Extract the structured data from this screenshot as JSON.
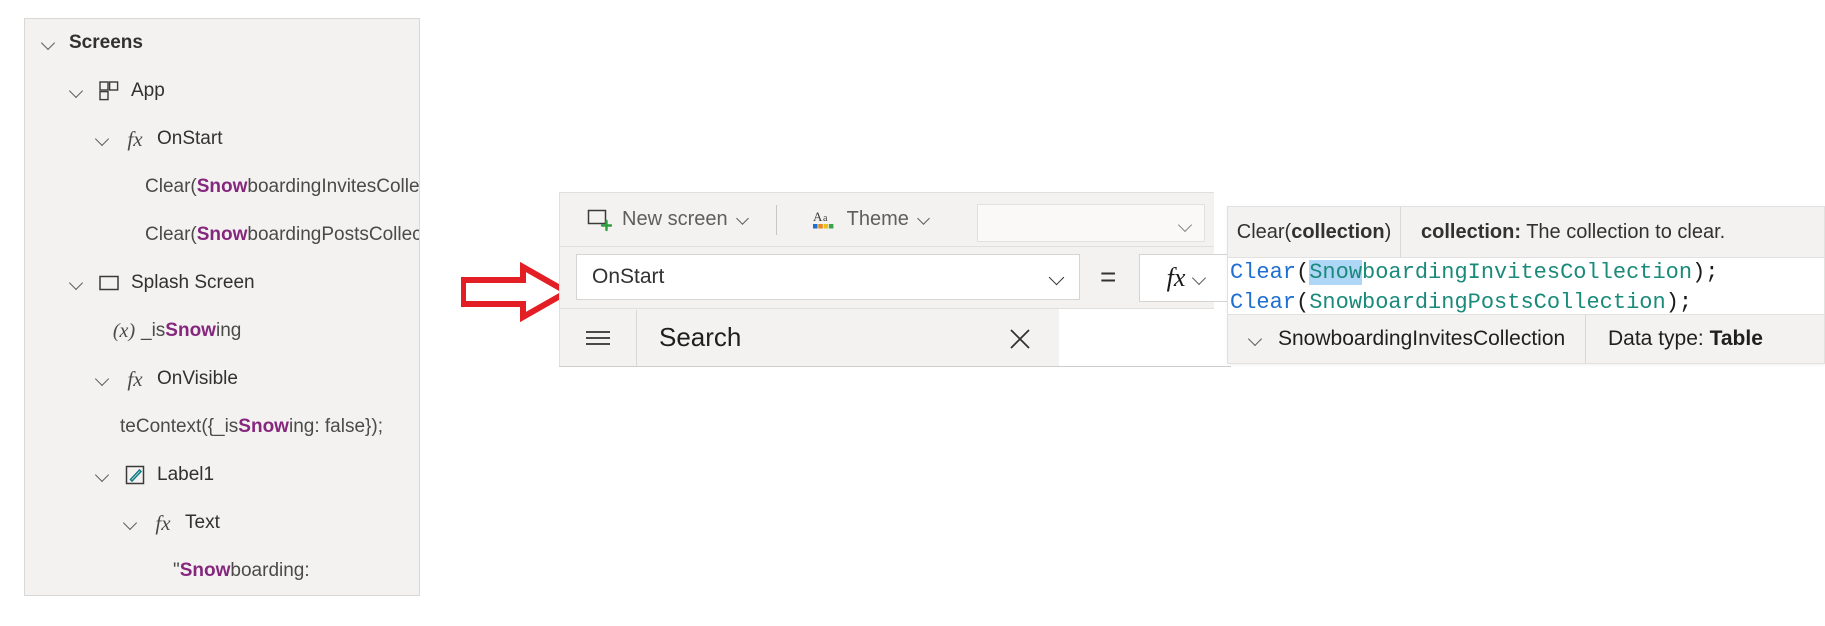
{
  "tree_panel": {
    "title": "Screens",
    "items": [
      {
        "label": "Screens",
        "icon": "none",
        "indent": 0,
        "bold": true,
        "expanded": true
      },
      {
        "label": "App",
        "icon": "app-grid-icon",
        "indent": 1,
        "bold": false,
        "expanded": true
      },
      {
        "label": "OnStart",
        "icon": "fx-icon",
        "indent": 2,
        "bold": false,
        "expanded": true
      },
      {
        "label_prefix": "Clear(",
        "label_highlight": "Snow",
        "label_suffix": "boardingInvitesColle...",
        "icon": "none",
        "indent": 4,
        "code": true
      },
      {
        "label_prefix": "Clear(",
        "label_highlight": "Snow",
        "label_suffix": "boardingPostsCollec...",
        "icon": "none",
        "indent": 4,
        "code": true
      },
      {
        "label": "Splash Screen",
        "icon": "screen-icon",
        "indent": 1,
        "bold": false,
        "expanded": true
      },
      {
        "label_prefix": "_is",
        "label_highlight": "Snow",
        "label_suffix": "ing",
        "icon": "variable-icon",
        "indent": 2,
        "code": true
      },
      {
        "label": "OnVisible",
        "icon": "fx-icon",
        "indent": 2,
        "bold": false,
        "expanded": true
      },
      {
        "label_prefix": "teContext({_is",
        "label_highlight": "Snow",
        "label_suffix": "ing: false});",
        "icon": "none",
        "indent": 3,
        "code": true
      },
      {
        "label": "Label1",
        "icon": "label-edit-icon",
        "indent": 2,
        "bold": false,
        "expanded": true
      },
      {
        "label": "Text",
        "icon": "fx-icon",
        "indent": 3,
        "bold": false,
        "expanded": true
      },
      {
        "label_prefix": "\"",
        "label_highlight": "Snow",
        "label_suffix": "boarding:",
        "icon": "none",
        "indent": 4,
        "code": true
      }
    ]
  },
  "arrow": {
    "direction": "right",
    "color": "#e31e24"
  },
  "powerapps": {
    "command_bar": {
      "new_screen_label": "New screen",
      "new_screen_icon": "new-screen-icon",
      "theme_label": "Theme",
      "theme_icon": "theme-aa-icon",
      "caret_icon": "chevron-down-icon"
    },
    "property_selector": {
      "value": "OnStart",
      "caret_icon": "chevron-down-icon"
    },
    "equals_sign": "=",
    "fx_button": {
      "glyph": "fx",
      "caret_icon": "chevron-down-icon"
    },
    "search_bar": {
      "menu_icon": "hamburger-icon",
      "value": "Search",
      "clear_icon": "close-icon"
    }
  },
  "intellisense": {
    "tooltip": {
      "signature_prefix": "Clear(",
      "signature_param": "collection",
      "signature_suffix": ")",
      "description_param": "collection:",
      "description_text": "The collection to clear."
    },
    "formula_lines": [
      {
        "fn": "Clear",
        "open": "(",
        "selected": "Snow",
        "ident": "boardingInvitesCollection",
        "close": ")",
        "semi": ";"
      },
      {
        "fn": "Clear",
        "open": "(",
        "selected": "",
        "ident": "SnowboardingPostsCollection",
        "close": ")",
        "semi": ";"
      }
    ],
    "suggestion": {
      "chevron_icon": "chevron-down-icon",
      "name": "SnowboardingInvitesCollection",
      "data_type_label": "Data type:",
      "data_type_value": "Table"
    }
  },
  "colors": {
    "panel_bg": "#f3f2f1",
    "highlight_purple": "#86277e",
    "code_function_blue": "#1f6fd0",
    "code_identifier_teal": "#1a8a7a",
    "selection_blue": "#aed6f7",
    "arrow_red": "#e31e24"
  }
}
